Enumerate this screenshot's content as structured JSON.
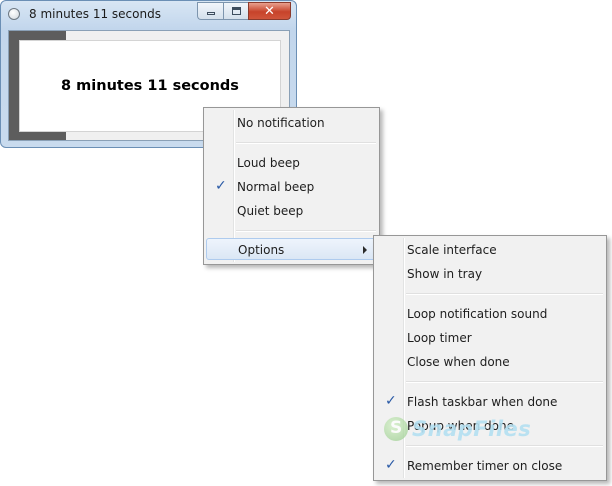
{
  "window": {
    "title": "8 minutes 11 seconds",
    "display_text": "8 minutes 11 seconds",
    "caption_buttons": {
      "minimize": "minimize-icon",
      "maximize": "maximize-icon",
      "close": "close-icon"
    },
    "close_glyph": "✕"
  },
  "context_menu": {
    "items": [
      {
        "label": "No notification",
        "checked": false
      },
      {
        "label": "Loud beep",
        "checked": false
      },
      {
        "label": "Normal beep",
        "checked": true
      },
      {
        "label": "Quiet beep",
        "checked": false
      },
      {
        "label": "Options",
        "has_submenu": true,
        "highlighted": true
      }
    ]
  },
  "options_submenu": {
    "items": [
      {
        "label": "Scale interface",
        "checked": false
      },
      {
        "label": "Show in tray",
        "checked": false
      },
      {
        "label": "Loop notification sound",
        "checked": false
      },
      {
        "label": "Loop timer",
        "checked": false
      },
      {
        "label": "Close when done",
        "checked": false
      },
      {
        "label": "Flash taskbar when done",
        "checked": true
      },
      {
        "label": "Popup when done",
        "checked": false
      },
      {
        "label": "Remember timer on close",
        "checked": true
      }
    ]
  },
  "check_glyph": "✓",
  "watermark": {
    "text": "SnapFiles"
  },
  "colors": {
    "check": "#2a5aa6",
    "progress_fill": "#5d5d5d",
    "menu_highlight": "#dbe7f5",
    "window_frame": "#c2d6ec"
  }
}
